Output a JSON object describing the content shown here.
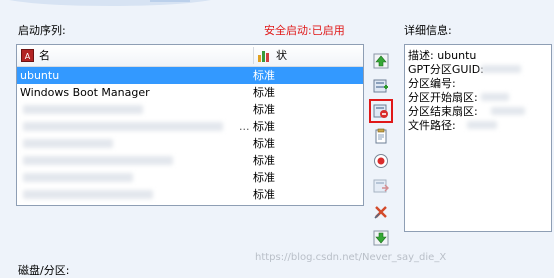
{
  "boot_sequence_label": "启动序列:",
  "secure_boot": {
    "label": "安全启动:",
    "status": "已启用",
    "color": "#e01818"
  },
  "details_label": "详细信息:",
  "list": {
    "columns": [
      "名称",
      "状态"
    ],
    "rows": [
      {
        "name": "ubuntu",
        "status": "标准",
        "selected": true
      },
      {
        "name": "Windows Boot Manager",
        "status": "标准"
      },
      {
        "name": "",
        "status": "标准"
      },
      {
        "name": "",
        "status": "标准"
      },
      {
        "name": "",
        "status": "标准"
      },
      {
        "name": "",
        "status": "标准"
      },
      {
        "name": "",
        "status": "标准"
      },
      {
        "name": "",
        "status": "标准"
      }
    ],
    "selection_color": "#3399ff"
  },
  "toolbar": {
    "icons": [
      "move-up-icon",
      "add-entry-icon",
      "delete-entry-icon",
      "copy-entry-icon",
      "record-icon",
      "export-icon",
      "remove-icon",
      "move-down-icon"
    ],
    "highlighted": "delete-entry-icon",
    "highlight_color": "#e01818"
  },
  "details": {
    "lines": [
      "描述: ubuntu",
      "GPT分区GUID:",
      "分区编号:",
      "分区开始扇区:",
      "分区结束扇区:",
      "文件路径:"
    ]
  },
  "disk_partition_label": "磁盘/分区:",
  "watermark": "https://blog.csdn.net/Never_say_die_X"
}
